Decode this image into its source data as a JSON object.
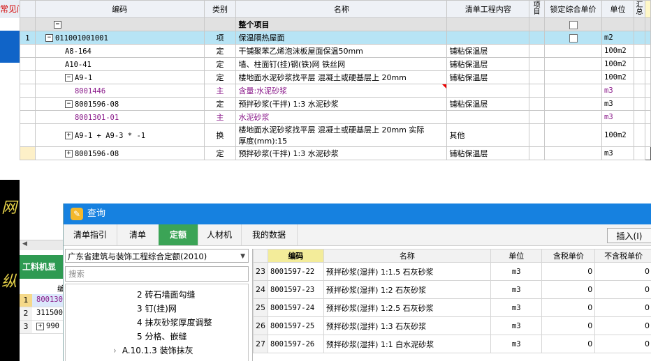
{
  "left_strip": {
    "tab_label": "常见问",
    "neon_glyphs": [
      "网",
      "纵"
    ]
  },
  "main_grid": {
    "headers": {
      "code": "编码",
      "type": "类别",
      "name": "名称",
      "content": "清单工程内容",
      "item": "项目",
      "lock": "锁定综合单价",
      "unit": "单位",
      "summary": "汇总"
    },
    "group_row": {
      "name": "整个项目",
      "tree_symbol": "−"
    },
    "rows": [
      {
        "num": "1",
        "sym": "−",
        "code": "011001001001",
        "type": "项",
        "name": "保温隔热屋面",
        "content": "",
        "unit": "m2",
        "check": true
      },
      {
        "num": "",
        "sym": "",
        "code": "A8-164",
        "type": "定",
        "name": "干铺聚苯乙烯泡沫板屋面保温50mm",
        "content": "铺粘保温层",
        "unit": "100m2"
      },
      {
        "num": "",
        "sym": "",
        "code": "A10-41",
        "type": "定",
        "name": "墙、柱面钉(挂)钢(铁)网 铁丝网",
        "content": "铺粘保温层",
        "unit": "100m2"
      },
      {
        "num": "",
        "sym": "−",
        "code": "A9-1",
        "type": "定",
        "name": "楼地面水泥砂浆找平层 混凝土或硬基层上 20mm",
        "content": "铺粘保温层",
        "unit": "100m2"
      },
      {
        "num": "",
        "sym": "",
        "code": "8001446",
        "type": "主",
        "name": "含量:水泥砂浆",
        "content": "",
        "unit": "m3",
        "purple": true
      },
      {
        "num": "",
        "sym": "−",
        "code": "8001596-08",
        "type": "定",
        "name": "预拌砂浆(干拌) 1:3 水泥砂浆",
        "content": "铺粘保温层",
        "unit": "m3"
      },
      {
        "num": "",
        "sym": "",
        "code": "8001301-01",
        "type": "主",
        "name": "水泥砂浆",
        "content": "",
        "unit": "m3",
        "purple": true
      },
      {
        "num": "",
        "sym": "+",
        "code": "A9-1 + A9-3 * -1",
        "type": "换",
        "name": "楼地面水泥砂浆找平层 混凝土或硬基层上 20mm  实际",
        "name2": "厚度(mm):15",
        "content": "其他",
        "unit": "100m2"
      },
      {
        "num": "",
        "sym": "+",
        "code": "8001596-08",
        "type": "定",
        "name": "预拌砂浆(干拌) 1:3 水泥砂浆",
        "content": "铺粘保温层",
        "unit": "m3"
      }
    ]
  },
  "bottom_left": {
    "green_label": "工料机显",
    "header_cell": "编",
    "rows": [
      {
        "num": "1",
        "code": "800130"
      },
      {
        "num": "2",
        "code": "311500"
      },
      {
        "num": "3",
        "code": "990"
      }
    ]
  },
  "dialog": {
    "title": "查询",
    "tabs": [
      "清单指引",
      "清单",
      "定额",
      "人材机",
      "我的数据"
    ],
    "active_tab": "定额",
    "insert_button": "插入(I)",
    "library": "广东省建筑与装饰工程综合定额(2010)",
    "search_placeholder": "搜索",
    "tree_items": [
      {
        "label": "2 砖石墙面勾缝"
      },
      {
        "label": "3 钉(挂)网"
      },
      {
        "label": "4 抹灰砂浆厚度调整"
      },
      {
        "label": "5 分格、嵌缝"
      },
      {
        "label": "A.10.1.3 装饰抹灰",
        "expander": "›"
      }
    ],
    "table": {
      "headers": {
        "code": "编码",
        "name": "名称",
        "unit": "单位",
        "tax_price": "含税单价",
        "notax_price": "不含税单价"
      },
      "rows": [
        {
          "num": "23",
          "code": "8001597-22",
          "name": "预拌砂浆(湿拌) 1:1.5 石灰砂浆",
          "unit": "m3",
          "tax": "0",
          "notax": "0"
        },
        {
          "num": "24",
          "code": "8001597-23",
          "name": "预拌砂浆(湿拌) 1:2 石灰砂浆",
          "unit": "m3",
          "tax": "0",
          "notax": "0"
        },
        {
          "num": "25",
          "code": "8001597-24",
          "name": "预拌砂浆(湿拌) 1:2.5 石灰砂浆",
          "unit": "m3",
          "tax": "0",
          "notax": "0"
        },
        {
          "num": "26",
          "code": "8001597-25",
          "name": "预拌砂浆(湿拌) 1:3 石灰砂浆",
          "unit": "m3",
          "tax": "0",
          "notax": "0"
        },
        {
          "num": "27",
          "code": "8001597-26",
          "name": "预拌砂浆(湿拌) 1:1 白水泥砂浆",
          "unit": "m3",
          "tax": "0",
          "notax": "0"
        }
      ]
    }
  },
  "colors": {
    "title_bar": "#1681e0",
    "active_tab": "#3ba456",
    "selected_row": "#b7e4f5",
    "purple_text": "#8a1a8a"
  }
}
